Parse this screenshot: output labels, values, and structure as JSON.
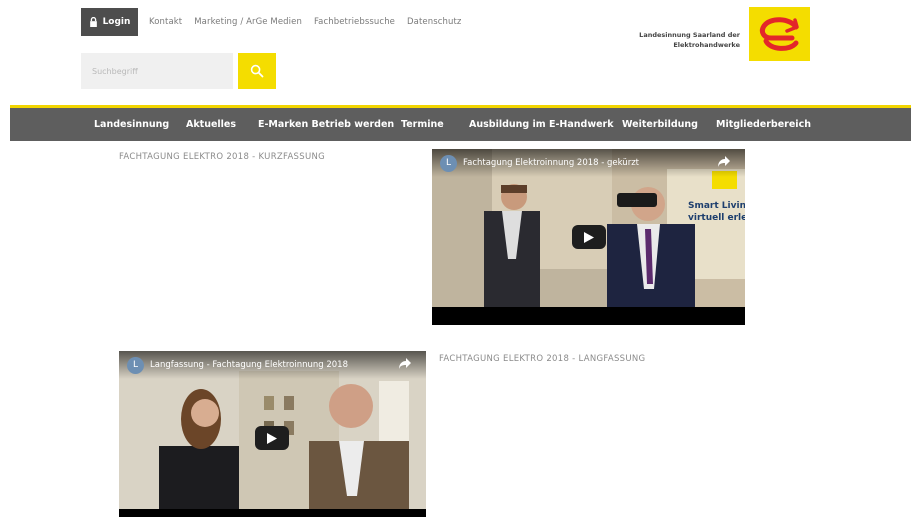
{
  "topbar": {
    "login_label": "Login",
    "links": [
      "Kontakt",
      "Marketing / ArGe Medien",
      "Fachbetriebssuche",
      "Datenschutz"
    ]
  },
  "search": {
    "placeholder": "Suchbegriff"
  },
  "brand": {
    "line1": "Landesinnung Saarland der",
    "line2": "Elektrohandwerke"
  },
  "mainnav": {
    "items": [
      "Landesinnung",
      "Aktuelles",
      "E-Marken Betrieb werden",
      "Termine",
      "Ausbildung im E-Handwerk",
      "Weiterbildung",
      "Mitgliederbereich"
    ]
  },
  "sections": [
    {
      "title": "FACHTAGUNG ELEKTRO 2018 - KURZFASSUNG",
      "video": {
        "channel_initial": "L",
        "title": "Fachtagung Elektroinnung 2018 - gekürzt",
        "poster_text_1": "Smart Livin",
        "poster_text_2": "virtuell erle"
      }
    },
    {
      "title": "FACHTAGUNG ELEKTRO 2018 - LANGFASSUNG",
      "video": {
        "channel_initial": "L",
        "title": "Langfassung - Fachtagung Elektroinnung 2018"
      }
    }
  ],
  "colors": {
    "accent": "#f4dd00",
    "nav_bg": "#5e5e5e",
    "login_bg": "#4d4d4d",
    "logo_red": "#e3262a"
  }
}
